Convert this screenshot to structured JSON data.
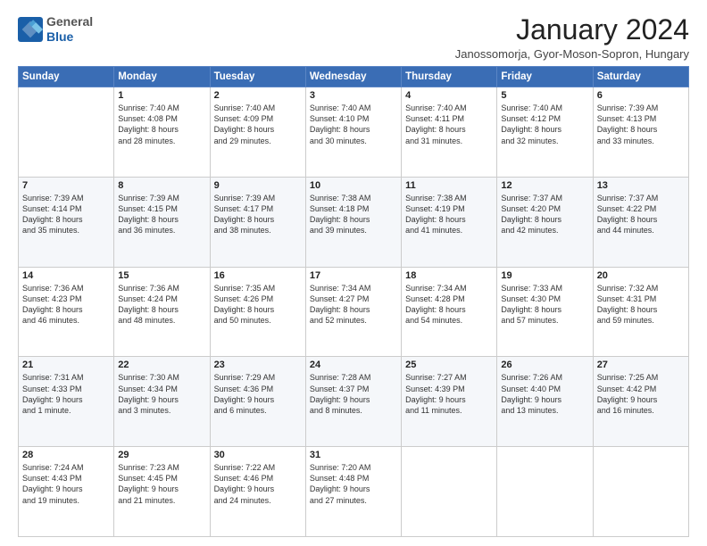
{
  "logo": {
    "general": "General",
    "blue": "Blue"
  },
  "title": "January 2024",
  "subtitle": "Janossomorja, Gyor-Moson-Sopron, Hungary",
  "days_header": [
    "Sunday",
    "Monday",
    "Tuesday",
    "Wednesday",
    "Thursday",
    "Friday",
    "Saturday"
  ],
  "weeks": [
    [
      {
        "num": "",
        "info": ""
      },
      {
        "num": "1",
        "info": "Sunrise: 7:40 AM\nSunset: 4:08 PM\nDaylight: 8 hours\nand 28 minutes."
      },
      {
        "num": "2",
        "info": "Sunrise: 7:40 AM\nSunset: 4:09 PM\nDaylight: 8 hours\nand 29 minutes."
      },
      {
        "num": "3",
        "info": "Sunrise: 7:40 AM\nSunset: 4:10 PM\nDaylight: 8 hours\nand 30 minutes."
      },
      {
        "num": "4",
        "info": "Sunrise: 7:40 AM\nSunset: 4:11 PM\nDaylight: 8 hours\nand 31 minutes."
      },
      {
        "num": "5",
        "info": "Sunrise: 7:40 AM\nSunset: 4:12 PM\nDaylight: 8 hours\nand 32 minutes."
      },
      {
        "num": "6",
        "info": "Sunrise: 7:39 AM\nSunset: 4:13 PM\nDaylight: 8 hours\nand 33 minutes."
      }
    ],
    [
      {
        "num": "7",
        "info": "Sunrise: 7:39 AM\nSunset: 4:14 PM\nDaylight: 8 hours\nand 35 minutes."
      },
      {
        "num": "8",
        "info": "Sunrise: 7:39 AM\nSunset: 4:15 PM\nDaylight: 8 hours\nand 36 minutes."
      },
      {
        "num": "9",
        "info": "Sunrise: 7:39 AM\nSunset: 4:17 PM\nDaylight: 8 hours\nand 38 minutes."
      },
      {
        "num": "10",
        "info": "Sunrise: 7:38 AM\nSunset: 4:18 PM\nDaylight: 8 hours\nand 39 minutes."
      },
      {
        "num": "11",
        "info": "Sunrise: 7:38 AM\nSunset: 4:19 PM\nDaylight: 8 hours\nand 41 minutes."
      },
      {
        "num": "12",
        "info": "Sunrise: 7:37 AM\nSunset: 4:20 PM\nDaylight: 8 hours\nand 42 minutes."
      },
      {
        "num": "13",
        "info": "Sunrise: 7:37 AM\nSunset: 4:22 PM\nDaylight: 8 hours\nand 44 minutes."
      }
    ],
    [
      {
        "num": "14",
        "info": "Sunrise: 7:36 AM\nSunset: 4:23 PM\nDaylight: 8 hours\nand 46 minutes."
      },
      {
        "num": "15",
        "info": "Sunrise: 7:36 AM\nSunset: 4:24 PM\nDaylight: 8 hours\nand 48 minutes."
      },
      {
        "num": "16",
        "info": "Sunrise: 7:35 AM\nSunset: 4:26 PM\nDaylight: 8 hours\nand 50 minutes."
      },
      {
        "num": "17",
        "info": "Sunrise: 7:34 AM\nSunset: 4:27 PM\nDaylight: 8 hours\nand 52 minutes."
      },
      {
        "num": "18",
        "info": "Sunrise: 7:34 AM\nSunset: 4:28 PM\nDaylight: 8 hours\nand 54 minutes."
      },
      {
        "num": "19",
        "info": "Sunrise: 7:33 AM\nSunset: 4:30 PM\nDaylight: 8 hours\nand 57 minutes."
      },
      {
        "num": "20",
        "info": "Sunrise: 7:32 AM\nSunset: 4:31 PM\nDaylight: 8 hours\nand 59 minutes."
      }
    ],
    [
      {
        "num": "21",
        "info": "Sunrise: 7:31 AM\nSunset: 4:33 PM\nDaylight: 9 hours\nand 1 minute."
      },
      {
        "num": "22",
        "info": "Sunrise: 7:30 AM\nSunset: 4:34 PM\nDaylight: 9 hours\nand 3 minutes."
      },
      {
        "num": "23",
        "info": "Sunrise: 7:29 AM\nSunset: 4:36 PM\nDaylight: 9 hours\nand 6 minutes."
      },
      {
        "num": "24",
        "info": "Sunrise: 7:28 AM\nSunset: 4:37 PM\nDaylight: 9 hours\nand 8 minutes."
      },
      {
        "num": "25",
        "info": "Sunrise: 7:27 AM\nSunset: 4:39 PM\nDaylight: 9 hours\nand 11 minutes."
      },
      {
        "num": "26",
        "info": "Sunrise: 7:26 AM\nSunset: 4:40 PM\nDaylight: 9 hours\nand 13 minutes."
      },
      {
        "num": "27",
        "info": "Sunrise: 7:25 AM\nSunset: 4:42 PM\nDaylight: 9 hours\nand 16 minutes."
      }
    ],
    [
      {
        "num": "28",
        "info": "Sunrise: 7:24 AM\nSunset: 4:43 PM\nDaylight: 9 hours\nand 19 minutes."
      },
      {
        "num": "29",
        "info": "Sunrise: 7:23 AM\nSunset: 4:45 PM\nDaylight: 9 hours\nand 21 minutes."
      },
      {
        "num": "30",
        "info": "Sunrise: 7:22 AM\nSunset: 4:46 PM\nDaylight: 9 hours\nand 24 minutes."
      },
      {
        "num": "31",
        "info": "Sunrise: 7:20 AM\nSunset: 4:48 PM\nDaylight: 9 hours\nand 27 minutes."
      },
      {
        "num": "",
        "info": ""
      },
      {
        "num": "",
        "info": ""
      },
      {
        "num": "",
        "info": ""
      }
    ]
  ]
}
